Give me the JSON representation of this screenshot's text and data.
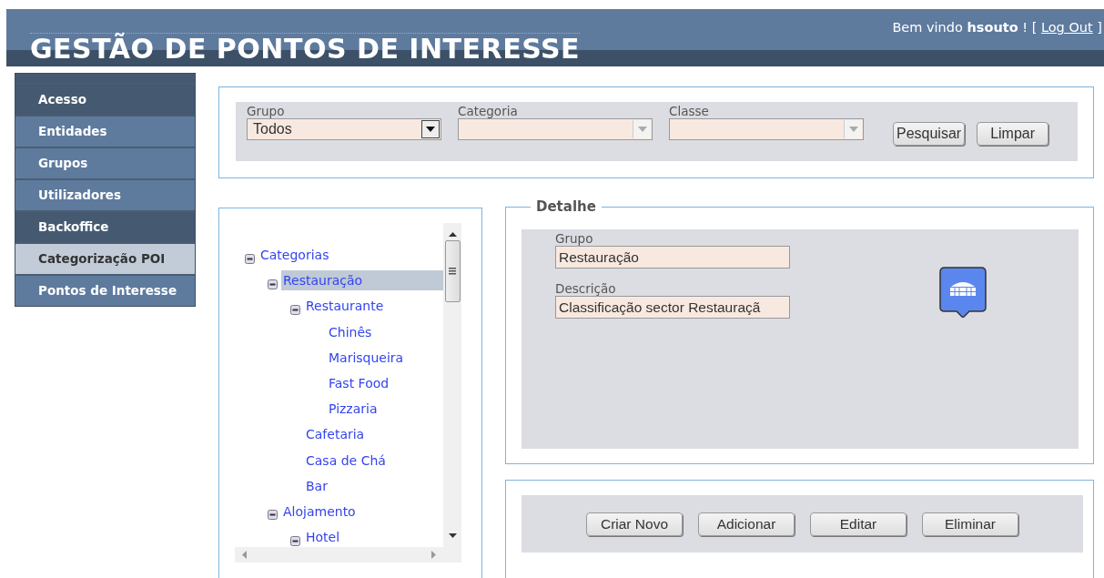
{
  "header": {
    "title": "GESTÃO DE PONTOS DE INTERESSE",
    "welcome": {
      "text": "Bem vindo **hsouto** ! [",
      "link": "Log Out",
      "suffix": "]"
    }
  },
  "sidebar": {
    "items": [
      {
        "label": "Acesso",
        "kind": "header",
        "selected": false
      },
      {
        "label": "Entidades",
        "kind": "link",
        "selected": false
      },
      {
        "label": "Grupos",
        "kind": "link",
        "selected": false
      },
      {
        "label": "Utilizadores",
        "kind": "link",
        "selected": false
      },
      {
        "label": "Backoffice",
        "kind": "header",
        "selected": false
      },
      {
        "label": "Categorização POI",
        "kind": "link",
        "selected": true
      },
      {
        "label": "Pontos de Interesse",
        "kind": "link",
        "selected": false
      }
    ]
  },
  "filter": {
    "fields": [
      {
        "label": "Grupo",
        "value": "Todos",
        "disabled": false
      },
      {
        "label": "Categoria",
        "disabled": true
      },
      {
        "label": "Classe",
        "disabled": true
      }
    ],
    "buttons": [
      "Pesquisar",
      "Limpar"
    ]
  },
  "tree": {
    "items": [
      {
        "label": "Categorias",
        "expanded": true,
        "selected": false,
        "children": [
          {
            "label": "Restauração",
            "expanded": true,
            "selected": true,
            "children": [
              {
                "label": "Restaurante",
                "expanded": true,
                "selected": false,
                "children": [
                  {
                    "label": "Chinês",
                    "selected": false
                  },
                  {
                    "label": "Marisqueira",
                    "selected": false
                  },
                  {
                    "label": "Fast Food",
                    "selected": false
                  },
                  {
                    "label": "Pizzaria",
                    "selected": false
                  }
                ]
              },
              {
                "label": "Cafetaria",
                "selected": false
              },
              {
                "label": "Casa de Chá",
                "selected": false
              },
              {
                "label": "Bar",
                "selected": false
              }
            ]
          },
          {
            "label": "Alojamento",
            "expanded": true,
            "selected": false,
            "children": [
              {
                "label": "Hotel",
                "expanded": true,
                "selected": false
              }
            ]
          }
        ]
      }
    ]
  },
  "detail": {
    "title": "Detalhe",
    "fields": [
      {
        "label": "Grupo",
        "value": "Restauração"
      },
      {
        "label": "Descrição",
        "value": "Classificação sector Restauraçã"
      }
    ]
  },
  "actions": {
    "buttons": [
      "Criar Novo",
      "Adicionar",
      "Editar",
      "Eliminar"
    ]
  }
}
